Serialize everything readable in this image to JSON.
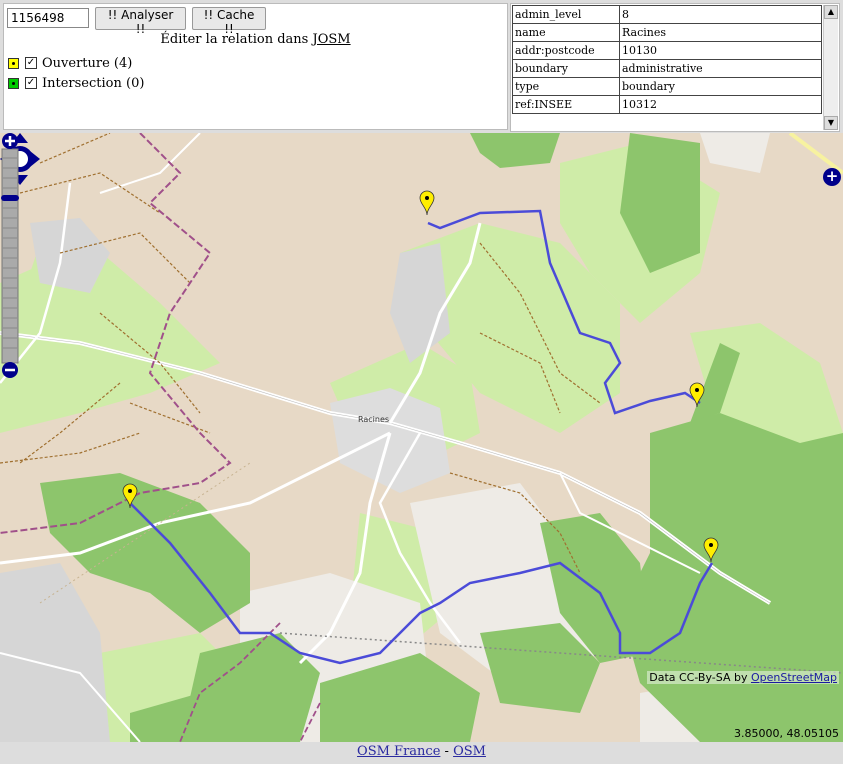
{
  "controls": {
    "relation_id_value": "1156498",
    "analyse_label": "!! Analyser !!",
    "cache_label": "!! Cache !!",
    "edit_prefix": "Éditer la relation dans",
    "edit_link": "JOSM",
    "legend": [
      {
        "label": "Ouverture (4)",
        "swatch_color": "#ffff00",
        "checked": true
      },
      {
        "label": "Intersection (0)",
        "swatch_color": "#00cc00",
        "checked": true
      }
    ]
  },
  "tags": [
    {
      "key": "admin_level",
      "value": "8"
    },
    {
      "key": "name",
      "value": "Racines"
    },
    {
      "key": "addr:postcode",
      "value": "10130"
    },
    {
      "key": "boundary",
      "value": "administrative"
    },
    {
      "key": "type",
      "value": "boundary"
    },
    {
      "key": "ref:INSEE",
      "value": "10312"
    }
  ],
  "map": {
    "place_label": "Racines",
    "attribution_prefix": "Data CC-By-SA by",
    "attribution_link": "OpenStreetMap",
    "coordinates": "3.85000, 48.05105",
    "layer_switcher_icon": "+",
    "colors": {
      "land": "#e7d9c6",
      "forest": "#8dc56c",
      "meadow": "#cfeca8",
      "urban": "#dddddd",
      "relation": "#4b4bd8",
      "marker": "#ffee00"
    }
  },
  "footer": {
    "link1": "OSM France",
    "separator": " - ",
    "link2": "OSM"
  }
}
